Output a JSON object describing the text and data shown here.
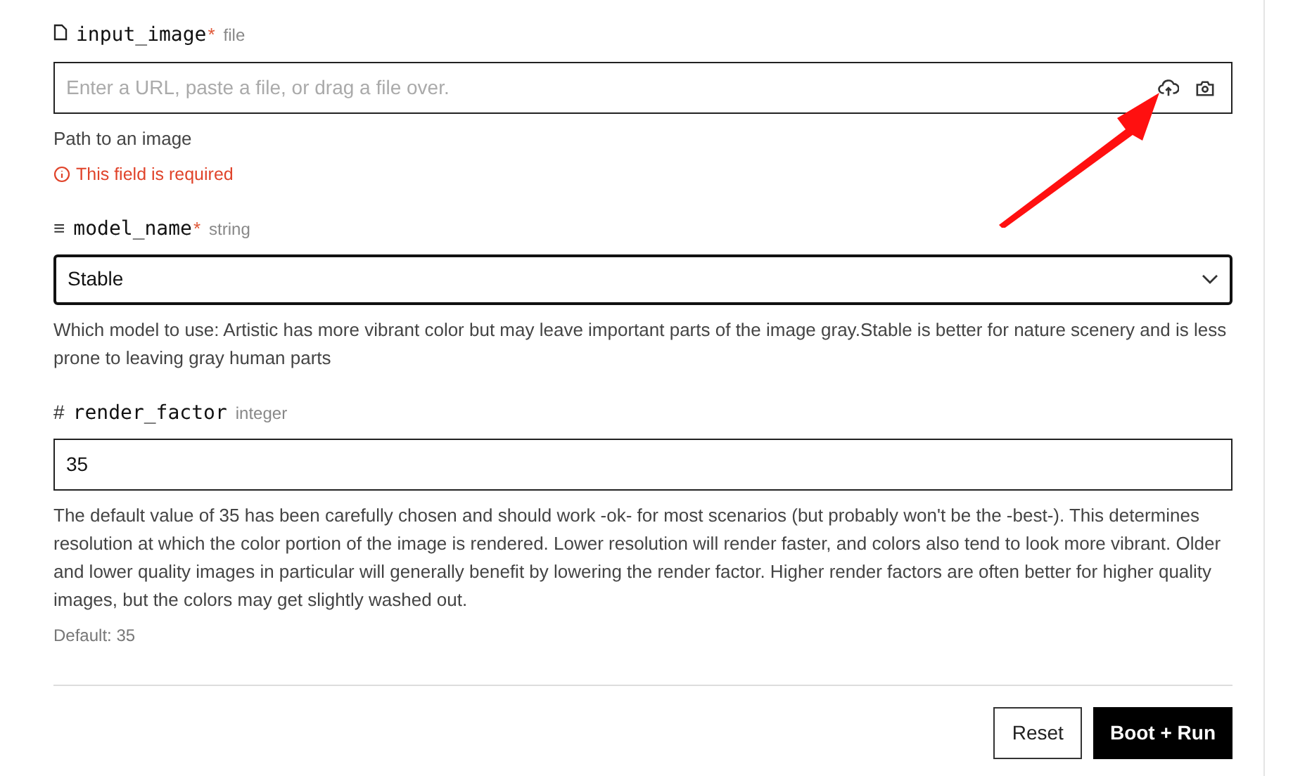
{
  "fields": [
    {
      "kind": "file",
      "name": "input_image",
      "required_mark": "*",
      "type": "file",
      "placeholder": "Enter a URL, paste a file, or drag a file over.",
      "help": "Path to an image",
      "error": "This field is required"
    },
    {
      "kind": "select",
      "name": "model_name",
      "icon": "≡",
      "required_mark": "*",
      "type": "string",
      "value": "Stable",
      "focused": true,
      "help": "Which model to use: Artistic has more vibrant color but may leave important parts of the image gray.Stable is better for nature scenery and is less prone to leaving gray human parts"
    },
    {
      "kind": "number",
      "name": "render_factor",
      "icon": "#",
      "type": "integer",
      "value": "35",
      "help": "The default value of 35 has been carefully chosen and should work -ok- for most scenarios (but probably won't be the -best-). This determines resolution at which the color portion of the image is rendered. Lower resolution will render faster, and colors also tend to look more vibrant. Older and lower quality images in particular will generally benefit by lowering the render factor. Higher render factors are often better for higher quality images, but the colors may get slightly washed out.",
      "default": "Default: 35"
    }
  ],
  "buttons": [
    {
      "label": "Reset",
      "kind": "secondary"
    },
    {
      "label": "Boot + Run",
      "kind": "primary"
    }
  ]
}
